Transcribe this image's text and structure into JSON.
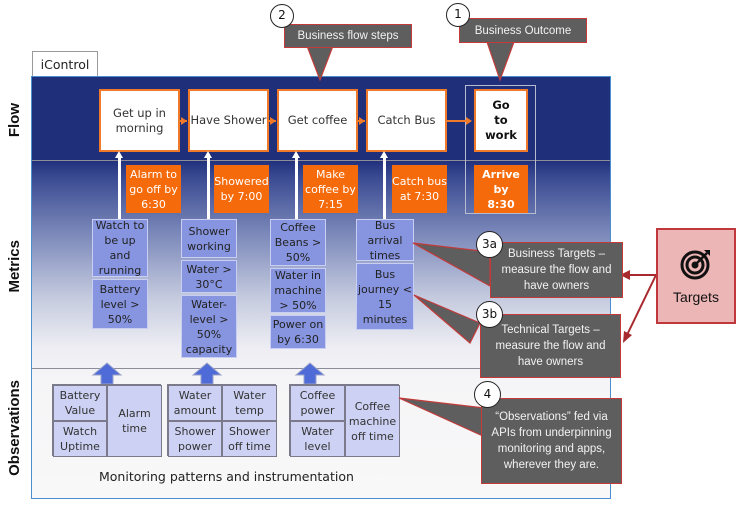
{
  "tab": {
    "label": "iControl"
  },
  "sections": {
    "flow": "Flow",
    "metrics": "Metrics",
    "observations": "Observations"
  },
  "flow_steps": [
    {
      "label": "Get up in morning"
    },
    {
      "label": "Have Shower"
    },
    {
      "label": "Get coffee"
    },
    {
      "label": "Catch Bus"
    },
    {
      "label": "Go to work"
    }
  ],
  "business_targets": [
    "Alarm to go off by 6:30",
    "Showered by 7:00",
    "Make coffee by 7:15",
    "Catch bus at 7:30",
    "Arrive by 8:30"
  ],
  "metrics": [
    [
      "Watch to be up and running",
      "Battery level > 50%"
    ],
    [
      "Shower working",
      "Water > 30°C",
      "Water-level > 50% capacity"
    ],
    [
      "Coffee Beans > 50%",
      "Water in machine > 50%",
      "Power on by 6:30"
    ],
    [
      "Bus arrival times",
      "Bus journey < 15 minutes"
    ]
  ],
  "observations": [
    {
      "cells": [
        "Battery Value",
        "Watch Uptime",
        "Alarm time"
      ]
    },
    {
      "cells": [
        "Water amount",
        "Water temp",
        "Shower power",
        "Shower off time"
      ]
    },
    {
      "cells": [
        "Coffee power",
        "Water level",
        "Coffee machine off time"
      ]
    }
  ],
  "monitoring_label": "Monitoring patterns and instrumentation",
  "callouts": {
    "business_outcome": {
      "badge": "1",
      "text": "Business Outcome"
    },
    "flow_steps": {
      "badge": "2",
      "text": "Business flow steps"
    },
    "business_targets": {
      "badge": "3a",
      "text": "Business Targets – measure the flow and have owners"
    },
    "technical_targets": {
      "badge": "3b",
      "text": "Technical Targets – measure the flow and have owners"
    },
    "observations": {
      "badge": "4",
      "text": "“Observations” fed via APIs from underpinning monitoring and apps, wherever they are."
    }
  },
  "targets_panel": {
    "label": "Targets",
    "icon": "target-icon"
  },
  "colors": {
    "flow_bg": "#1f2f7a",
    "accent_orange": "#f56a0a",
    "metric_blue": "#8795e0",
    "observation_blue": "#cdd2f4",
    "callout_gray": "#5e5e5e",
    "callout_border": "#c43a3a",
    "targets_bg": "#ecb6b6"
  }
}
